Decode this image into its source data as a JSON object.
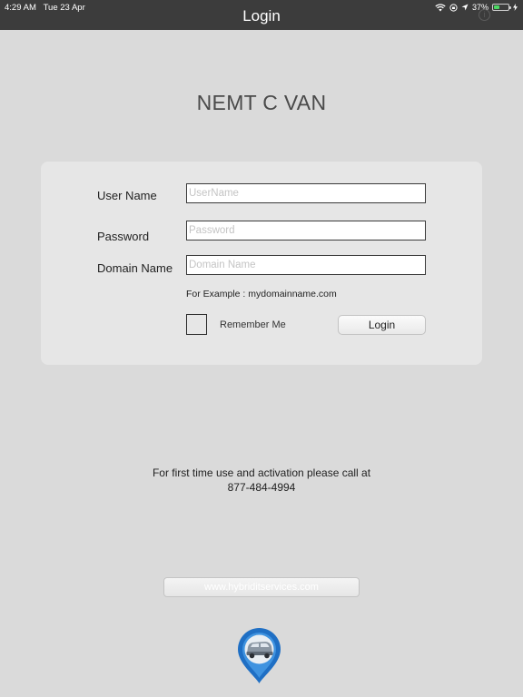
{
  "status_bar": {
    "time": "4:29 AM",
    "date": "Tue 23 Apr",
    "battery_text": "37%",
    "battery_level_percent": 37,
    "icons": [
      "wifi-icon",
      "orientation-lock-icon",
      "location-icon",
      "battery-icon",
      "charging-icon"
    ]
  },
  "nav": {
    "title": "Login",
    "info_icon_glyph": "i"
  },
  "app_title": "NEMT C VAN",
  "form": {
    "username_label": "User Name",
    "username_placeholder": "UserName",
    "username_value": "",
    "password_label": "Password",
    "password_placeholder": "Password",
    "password_value": "",
    "domain_label": "Domain Name",
    "domain_placeholder": "Domain Name",
    "domain_value": "",
    "example_text": "For Example : mydomainname.com",
    "remember_label": "Remember Me",
    "remember_checked": false,
    "login_button_label": "Login"
  },
  "activation": {
    "line1": "For first time use and activation please call at",
    "line2": "877-484-4994"
  },
  "website_button_label": "www.hybriditservices.com",
  "colors": {
    "background": "#dadada",
    "topbar": "#3c3c3c",
    "card": "#e6e6e6",
    "logo_blue": "#1f6fc4",
    "battery_green": "#4cd964"
  }
}
